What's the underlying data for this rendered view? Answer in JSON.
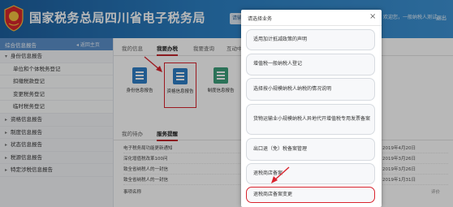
{
  "header": {
    "site_title": "国家税务总局四川省电子税务局",
    "tag_text": "请输",
    "user_text": "欢迎您，一般纳税人测试...",
    "exit_label": "退出"
  },
  "sidebar": {
    "title": "综合信息报告",
    "back_label": "◂ 返回主页",
    "items": [
      {
        "label": "身份信息报告",
        "sub": false,
        "arrow": "▾"
      },
      {
        "label": "单位和个体税务登记",
        "sub": true,
        "arrow": ""
      },
      {
        "label": "扣缴税款登记",
        "sub": true,
        "arrow": ""
      },
      {
        "label": "变更税务登记",
        "sub": true,
        "arrow": ""
      },
      {
        "label": "临时税务登记",
        "sub": true,
        "arrow": ""
      },
      {
        "label": "资格信息报告",
        "sub": false,
        "arrow": "▸"
      },
      {
        "label": "制度信息报告",
        "sub": false,
        "arrow": "▸"
      },
      {
        "label": "状态信息报告",
        "sub": false,
        "arrow": "▸"
      },
      {
        "label": "税源信息报告",
        "sub": false,
        "arrow": "▸"
      },
      {
        "label": "特定涉税信息报告",
        "sub": false,
        "arrow": "▸"
      }
    ]
  },
  "main": {
    "tabs": [
      {
        "label": "我的信息",
        "active": false
      },
      {
        "label": "我要办税",
        "active": true
      },
      {
        "label": "我要查询",
        "active": false
      },
      {
        "label": "互动中",
        "active": false
      }
    ],
    "tiles": [
      {
        "label": "身份信息报告",
        "highlight": false,
        "color": "blue"
      },
      {
        "label": "资格信息报告",
        "highlight": true,
        "color": "blue"
      },
      {
        "label": "制度信息报告",
        "highlight": false,
        "color": "green"
      }
    ],
    "tabs2": [
      {
        "label": "我的待办",
        "active": false
      },
      {
        "label": "服务提醒",
        "active": true
      }
    ],
    "rows": [
      {
        "name": "电子税务局功能更新通知",
        "date": "2019年4月20日",
        "extra": ""
      },
      {
        "name": "深化增值税改革100问",
        "date": "2019年3月26日",
        "extra": ""
      },
      {
        "name": "致全省纳税人的一封信",
        "date": "2019年3月26日",
        "extra": ""
      },
      {
        "name": "致全省纳税人的一封信",
        "date": "2019年1月31日",
        "extra": ""
      },
      {
        "name": "事项名称",
        "date": "",
        "extra": "评价"
      }
    ]
  },
  "modal": {
    "title": "请选择业务",
    "close": "×",
    "options": [
      {
        "label": "适用加计抵减政策的声明",
        "highlight": false
      },
      {
        "label": "增值税一般纳税人登记",
        "highlight": false
      },
      {
        "label": "选择按小规模纳税人纳税的情况说明",
        "highlight": false
      },
      {
        "label": "货物运输业小规模纳税人异地代开增值税专用发票备案",
        "highlight": false
      },
      {
        "label": "出口退（免）税备案管理",
        "highlight": false
      },
      {
        "label": "退税商店备案",
        "highlight": false
      },
      {
        "label": "退税商店备案变更",
        "highlight": true
      }
    ]
  },
  "colors": {
    "header_blue": "#2b7fc3",
    "accent_red": "#d9232d",
    "sidebar_head": "#5a8fca"
  }
}
